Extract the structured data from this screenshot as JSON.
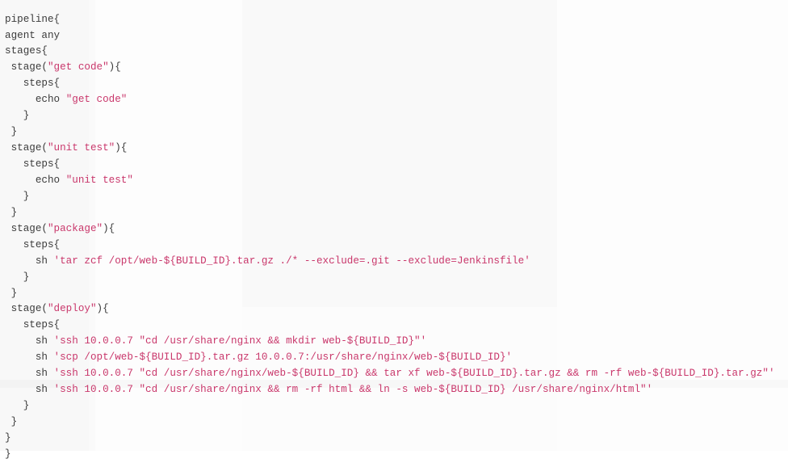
{
  "editor": {
    "language": "groovy",
    "file_kind": "Jenkinsfile",
    "colors": {
      "background": "#fdfdfd",
      "default_text": "#3b3b3b",
      "string_literal": "#c9376b"
    }
  },
  "code": {
    "lines": [
      {
        "n": 1,
        "indent": 0,
        "segments": [
          {
            "t": "plain",
            "v": "pipeline{"
          }
        ]
      },
      {
        "n": 2,
        "indent": 0,
        "segments": [
          {
            "t": "plain",
            "v": "agent any"
          }
        ]
      },
      {
        "n": 3,
        "indent": 0,
        "segments": [
          {
            "t": "plain",
            "v": "stages{"
          }
        ]
      },
      {
        "n": 4,
        "indent": 1,
        "segments": [
          {
            "t": "plain",
            "v": "stage("
          },
          {
            "t": "str",
            "v": "\"get code\""
          },
          {
            "t": "plain",
            "v": "){"
          }
        ]
      },
      {
        "n": 5,
        "indent": 3,
        "segments": [
          {
            "t": "plain",
            "v": "steps{"
          }
        ]
      },
      {
        "n": 6,
        "indent": 5,
        "segments": [
          {
            "t": "plain",
            "v": "echo "
          },
          {
            "t": "str",
            "v": "\"get code\""
          }
        ]
      },
      {
        "n": 7,
        "indent": 3,
        "segments": [
          {
            "t": "plain",
            "v": "}"
          }
        ]
      },
      {
        "n": 8,
        "indent": 1,
        "segments": [
          {
            "t": "plain",
            "v": "}"
          }
        ]
      },
      {
        "n": 9,
        "indent": 1,
        "segments": [
          {
            "t": "plain",
            "v": "stage("
          },
          {
            "t": "str",
            "v": "\"unit test\""
          },
          {
            "t": "plain",
            "v": "){"
          }
        ]
      },
      {
        "n": 10,
        "indent": 3,
        "segments": [
          {
            "t": "plain",
            "v": "steps{"
          }
        ]
      },
      {
        "n": 11,
        "indent": 5,
        "segments": [
          {
            "t": "plain",
            "v": "echo "
          },
          {
            "t": "str",
            "v": "\"unit test\""
          }
        ]
      },
      {
        "n": 12,
        "indent": 3,
        "segments": [
          {
            "t": "plain",
            "v": "}"
          }
        ]
      },
      {
        "n": 13,
        "indent": 1,
        "segments": [
          {
            "t": "plain",
            "v": "}"
          }
        ]
      },
      {
        "n": 14,
        "indent": 1,
        "segments": [
          {
            "t": "plain",
            "v": "stage("
          },
          {
            "t": "str",
            "v": "\"package\""
          },
          {
            "t": "plain",
            "v": "){"
          }
        ]
      },
      {
        "n": 15,
        "indent": 3,
        "segments": [
          {
            "t": "plain",
            "v": "steps{"
          }
        ]
      },
      {
        "n": 16,
        "indent": 5,
        "segments": [
          {
            "t": "plain",
            "v": "sh "
          },
          {
            "t": "str",
            "v": "'tar zcf /opt/web-${BUILD_ID}.tar.gz ./* --exclude=.git --exclude=Jenkinsfile'"
          }
        ]
      },
      {
        "n": 17,
        "indent": 3,
        "segments": [
          {
            "t": "plain",
            "v": "}"
          }
        ]
      },
      {
        "n": 18,
        "indent": 1,
        "segments": [
          {
            "t": "plain",
            "v": "}"
          }
        ]
      },
      {
        "n": 19,
        "indent": 1,
        "segments": [
          {
            "t": "plain",
            "v": "stage("
          },
          {
            "t": "str",
            "v": "\"deploy\""
          },
          {
            "t": "plain",
            "v": "){"
          }
        ]
      },
      {
        "n": 20,
        "indent": 3,
        "segments": [
          {
            "t": "plain",
            "v": "steps{"
          }
        ]
      },
      {
        "n": 21,
        "indent": 5,
        "segments": [
          {
            "t": "plain",
            "v": "sh "
          },
          {
            "t": "str",
            "v": "'ssh 10.0.0.7 \"cd /usr/share/nginx && mkdir web-${BUILD_ID}\"'"
          }
        ]
      },
      {
        "n": 22,
        "indent": 5,
        "segments": [
          {
            "t": "plain",
            "v": "sh "
          },
          {
            "t": "str",
            "v": "'scp /opt/web-${BUILD_ID}.tar.gz 10.0.0.7:/usr/share/nginx/web-${BUILD_ID}'"
          }
        ]
      },
      {
        "n": 23,
        "indent": 5,
        "segments": [
          {
            "t": "plain",
            "v": "sh "
          },
          {
            "t": "str",
            "v": "'ssh 10.0.0.7 \"cd /usr/share/nginx/web-${BUILD_ID} && tar xf web-${BUILD_ID}.tar.gz && rm -rf web-${BUILD_ID}.tar.gz\"'"
          }
        ]
      },
      {
        "n": 24,
        "indent": 5,
        "segments": [
          {
            "t": "plain",
            "v": "sh "
          },
          {
            "t": "str",
            "v": "'ssh 10.0.0.7 \"cd /usr/share/nginx && rm -rf html && ln -s web-${BUILD_ID} /usr/share/nginx/html\"'"
          }
        ]
      },
      {
        "n": 25,
        "indent": 3,
        "segments": [
          {
            "t": "plain",
            "v": "}"
          }
        ]
      },
      {
        "n": 26,
        "indent": 1,
        "segments": [
          {
            "t": "plain",
            "v": "}"
          }
        ]
      },
      {
        "n": 27,
        "indent": 0,
        "segments": [
          {
            "t": "plain",
            "v": "}"
          }
        ]
      },
      {
        "n": 28,
        "indent": 0,
        "segments": [
          {
            "t": "plain",
            "v": "}"
          }
        ]
      }
    ]
  }
}
